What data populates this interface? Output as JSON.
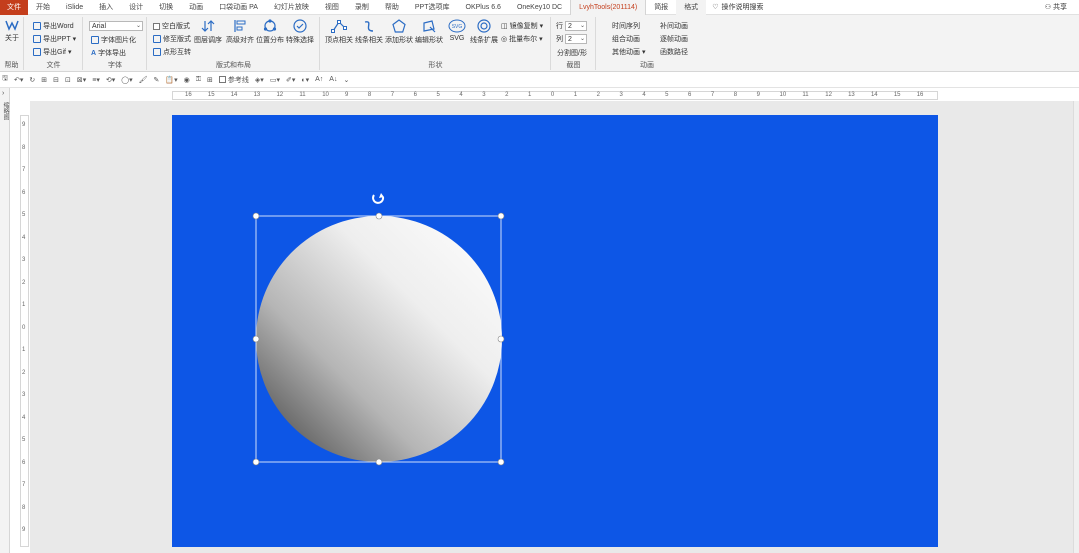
{
  "tabs": [
    "文件",
    "开始",
    "iSlide",
    "插入",
    "设计",
    "切换",
    "动画",
    "口袋动画 PA",
    "幻灯片放映",
    "视图",
    "录制",
    "帮助",
    "PPT选项库",
    "OKPlus 6.6",
    "OneKey10 DC",
    "LvyhTools(201114)",
    "简报",
    "格式"
  ],
  "tell_me": "操作说明搜索",
  "share": "共享",
  "ribbon": {
    "help_group": {
      "btn": "关于",
      "label": "帮助"
    },
    "file_group": {
      "items": [
        "导出Word",
        "导出PPT",
        "导出Gif"
      ],
      "label": "文件"
    },
    "font_group": {
      "font_value": "Arial",
      "items": [
        "字体图片化",
        "字体导出"
      ],
      "label": "字体"
    },
    "layout_group": {
      "checks": [
        "空白版式",
        "修至版式",
        "点形互转"
      ],
      "bigs": [
        "图层调序",
        "高级对齐",
        "位置分布",
        "特殊选择"
      ],
      "label": "版式和布局"
    },
    "shape_group": {
      "bigs": [
        "顶点相关",
        "线条相关",
        "添加形状",
        "编辑形状",
        "SVG",
        "线条扩展"
      ],
      "extra": [
        "镜像复制",
        "批量布尔"
      ],
      "label": "形状"
    },
    "crop_group": {
      "row_label": "行",
      "row_value": "2",
      "col_label": "列",
      "col_value": "2",
      "btn": "分割图/形",
      "label": "截图"
    },
    "anim_group": {
      "items": [
        "时间序列",
        "补间动画",
        "组合动画",
        "逐帧动画",
        "其他动画",
        "函数路径"
      ],
      "label": "动画"
    }
  },
  "qat": {
    "ref_line": "参考线"
  },
  "left_pane": {
    "label": "缩略图"
  },
  "ruler": {
    "h_ticks": [
      "16",
      "15",
      "14",
      "13",
      "12",
      "11",
      "10",
      "9",
      "8",
      "7",
      "6",
      "5",
      "4",
      "3",
      "2",
      "1",
      "0",
      "1",
      "2",
      "3",
      "4",
      "5",
      "6",
      "7",
      "8",
      "9",
      "10",
      "11",
      "12",
      "13",
      "14",
      "15",
      "16"
    ],
    "v_ticks": [
      "9",
      "8",
      "7",
      "6",
      "5",
      "4",
      "3",
      "2",
      "1",
      "0",
      "1",
      "2",
      "3",
      "4",
      "5",
      "6",
      "7",
      "8",
      "9"
    ]
  },
  "slide": {
    "background": "#0d56e6"
  }
}
